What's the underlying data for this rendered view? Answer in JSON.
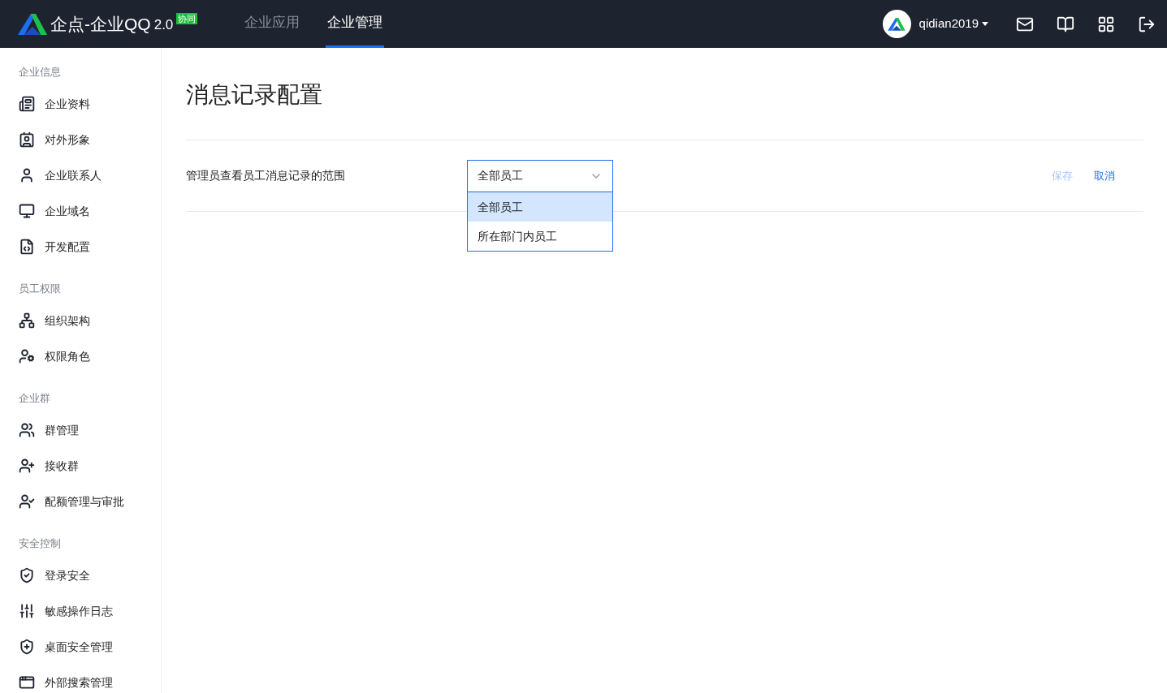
{
  "header": {
    "brand": "企点-企业QQ",
    "version": "2.0",
    "badge": "协同",
    "nav": [
      {
        "label": "企业应用",
        "selected": false
      },
      {
        "label": "企业管理",
        "selected": true
      }
    ],
    "user": "qidian2019"
  },
  "sidebar": {
    "groups": [
      {
        "title": "企业信息",
        "items": [
          "企业资料",
          "对外形象",
          "企业联系人",
          "企业域名",
          "开发配置"
        ]
      },
      {
        "title": "员工权限",
        "items": [
          "组织架构",
          "权限角色"
        ]
      },
      {
        "title": "企业群",
        "items": [
          "群管理",
          "接收群",
          "配额管理与审批"
        ]
      },
      {
        "title": "安全控制",
        "items": [
          "登录安全",
          "敏感操作日志",
          "桌面安全管理",
          "外部搜索管理"
        ]
      }
    ]
  },
  "page": {
    "title": "消息记录配置",
    "setting": {
      "label": "管理员查看员工消息记录的范围",
      "value": "全部员工",
      "options": [
        {
          "label": "全部员工",
          "selected": true
        },
        {
          "label": "所在部门内员工",
          "selected": false
        }
      ]
    },
    "buttons": [
      {
        "label": "保存",
        "disabled": true
      },
      {
        "label": "取消",
        "disabled": false
      }
    ]
  }
}
